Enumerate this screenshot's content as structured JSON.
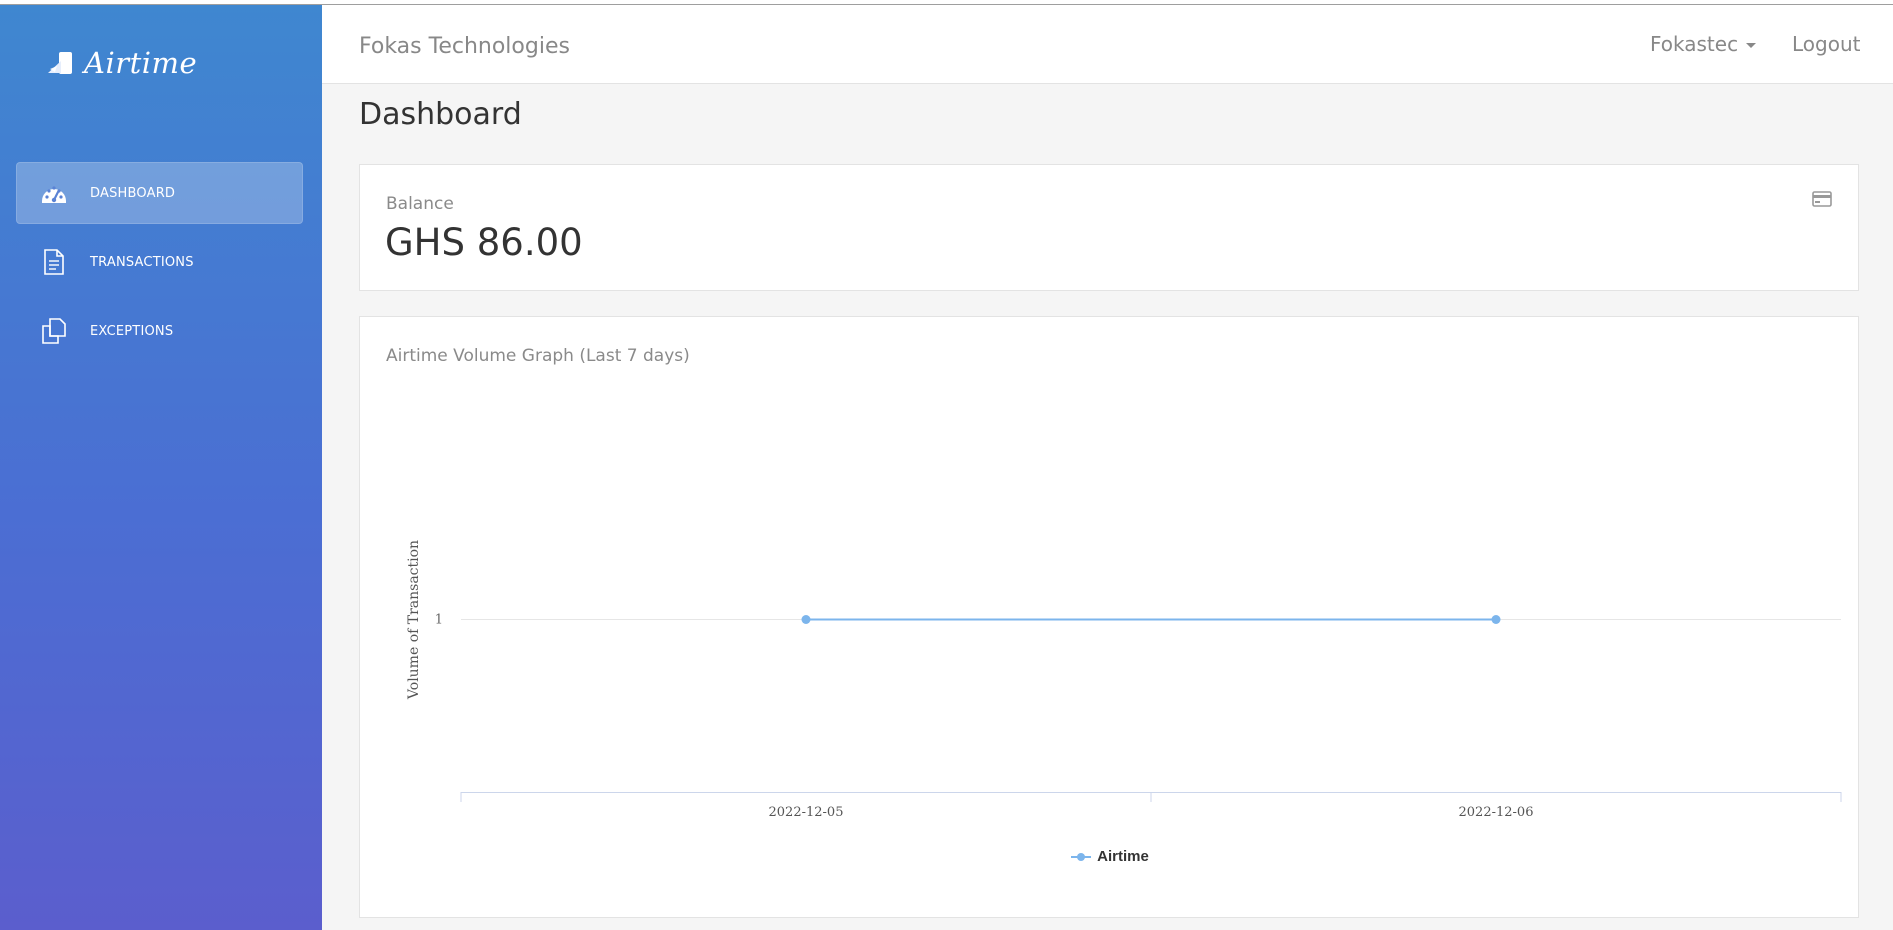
{
  "brand": {
    "name": "Airtime"
  },
  "sidebar": {
    "items": [
      {
        "label": "DASHBOARD",
        "icon": "dashboard-icon",
        "active": true
      },
      {
        "label": "TRANSACTIONS",
        "icon": "document-icon",
        "active": false
      },
      {
        "label": "EXCEPTIONS",
        "icon": "copy-icon",
        "active": false
      }
    ]
  },
  "header": {
    "company": "Fokas Technologies",
    "user": "Fokastec",
    "logout_label": "Logout"
  },
  "page": {
    "title": "Dashboard"
  },
  "balance": {
    "label": "Balance",
    "value": "GHS 86.00",
    "icon": "credit-card-icon"
  },
  "chart": {
    "title": "Airtime Volume Graph (Last 7 days)"
  },
  "colors": {
    "sidebar_top": "#3f87d0",
    "sidebar_bottom": "#5b5ecd",
    "series": "#7cb5ec"
  },
  "chart_data": {
    "type": "line",
    "title": "Airtime Volume Graph (Last 7 days)",
    "xlabel": "",
    "ylabel": "Volume of Transaction",
    "categories": [
      "2022-12-05",
      "2022-12-06"
    ],
    "series": [
      {
        "name": "Airtime",
        "values": [
          1,
          1
        ]
      }
    ],
    "yticks": [
      1
    ],
    "grid": true,
    "legend": "bottom-center"
  }
}
